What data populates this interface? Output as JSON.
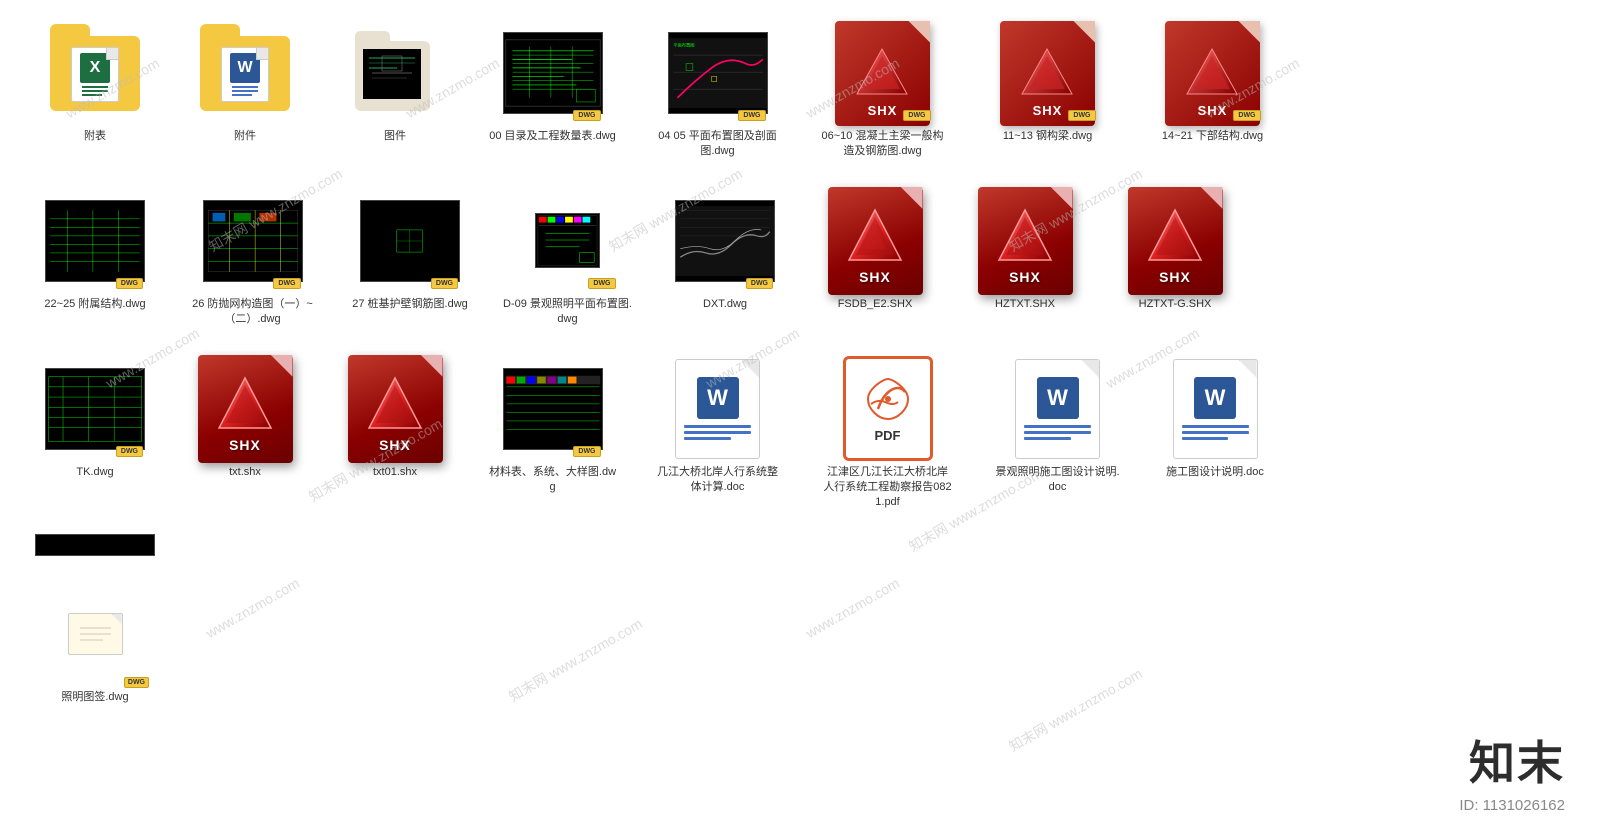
{
  "watermarks": [
    "www.znzmo.com",
    "知末网 www.znzmo.com",
    "www.znzmo.com",
    "知末网 www.znzmo.com"
  ],
  "brand": {
    "name": "知末",
    "id": "ID: 1131026162"
  },
  "files": [
    {
      "id": "f1",
      "type": "folder-excel",
      "label": "附表",
      "col": 1,
      "row": 1
    },
    {
      "id": "f2",
      "type": "folder-word",
      "label": "附件",
      "col": 2,
      "row": 1
    },
    {
      "id": "f3",
      "type": "folder-dark",
      "label": "图件",
      "col": 3,
      "row": 1
    },
    {
      "id": "f4",
      "type": "dwg-thumb-green",
      "label": "00 目录及工程数量表.dwg",
      "col": 4,
      "row": 1
    },
    {
      "id": "f5",
      "type": "dwg-thumb-map",
      "label": "04 05 平面布置图及剖面图.dwg",
      "col": 5,
      "row": 1
    },
    {
      "id": "f6",
      "type": "dwg-thumb-colored2",
      "label": "06~10 混凝土主梁一般构造及钢筋图.dwg",
      "col": 6,
      "row": 1
    },
    {
      "id": "f7",
      "type": "dwg-thumb-colored3",
      "label": "11~13 钢构梁.dwg",
      "col": 7,
      "row": 1
    },
    {
      "id": "f8",
      "type": "dwg-thumb-colored4",
      "label": "14~21 下部结构.dwg",
      "col": 8,
      "row": 1
    },
    {
      "id": "f9",
      "type": "dwg-thumb-black1",
      "label": "22~25 附属结构.dwg",
      "col": 1,
      "row": 2
    },
    {
      "id": "f10",
      "type": "dwg-thumb-colored5",
      "label": "26 防抛网构造图（一）~（二）.dwg",
      "col": 2,
      "row": 2
    },
    {
      "id": "f11",
      "type": "dwg-thumb-black2",
      "label": "27 桩基护壁钢筋图.dwg",
      "col": 3,
      "row": 2
    },
    {
      "id": "f12",
      "type": "dwg-thumb-small",
      "label": "D-09 景观照明平面布置图.dwg",
      "col": 4,
      "row": 2
    },
    {
      "id": "f13",
      "type": "dwg-thumb-map2",
      "label": "DXT.dwg",
      "col": 5,
      "row": 2
    },
    {
      "id": "f14",
      "type": "shx",
      "label": "FSDB_E2.SHX",
      "col": 6,
      "row": 2
    },
    {
      "id": "f15",
      "type": "shx",
      "label": "HZTXT.SHX",
      "col": 7,
      "row": 2
    },
    {
      "id": "f16",
      "type": "shx",
      "label": "HZTXT-G.SHX",
      "col": 8,
      "row": 2
    },
    {
      "id": "f17",
      "type": "dwg-thumb-black3",
      "label": "TK.dwg",
      "col": 1,
      "row": 3
    },
    {
      "id": "f18",
      "type": "shx",
      "label": "txt.shx",
      "col": 2,
      "row": 3
    },
    {
      "id": "f19",
      "type": "shx",
      "label": "txt01.shx",
      "col": 3,
      "row": 3
    },
    {
      "id": "f20",
      "type": "dwg-thumb-colored6",
      "label": "材料表、系统、大样图.dwg",
      "col": 4,
      "row": 3
    },
    {
      "id": "f21",
      "type": "word-doc",
      "label": "几江大桥北岸人行系统整体计算.doc",
      "col": 5,
      "row": 3
    },
    {
      "id": "f22",
      "type": "pdf",
      "label": "江津区几江长江大桥北岸人行系统工程勘察报告0821.pdf",
      "col": 6,
      "row": 3
    },
    {
      "id": "f23",
      "type": "word-doc",
      "label": "景观照明施工图设计说明.doc",
      "col": 7,
      "row": 3
    },
    {
      "id": "f24",
      "type": "word-doc",
      "label": "施工图设计说明.doc",
      "col": 8,
      "row": 3
    },
    {
      "id": "f25",
      "type": "dwg-small-standalone",
      "label": "照明图签.dwg",
      "col": 1,
      "row": 5
    }
  ]
}
